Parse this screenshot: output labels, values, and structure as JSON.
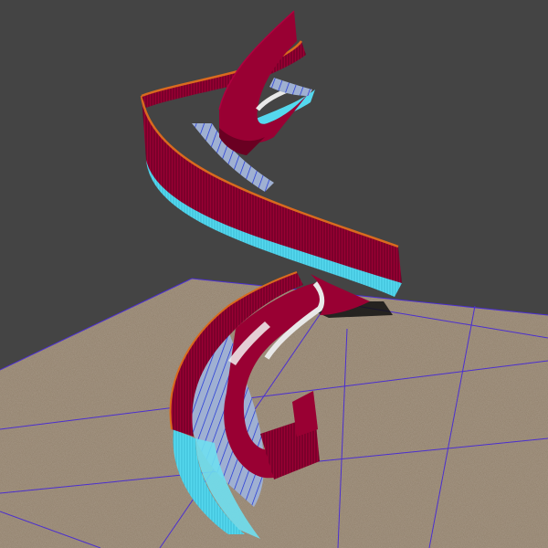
{
  "viewport": {
    "background": "#444444",
    "floor_color": "#8c7b66",
    "grid_color": "#4b2fd0",
    "panel_color": "#990033",
    "panel_edge_color": "#d96a1e",
    "stringer_color": "#55d8ee",
    "tread_color": "#8aa0c8",
    "tread_edge_color": "#1b2fd8",
    "riser_white": "#f2f2f2"
  }
}
